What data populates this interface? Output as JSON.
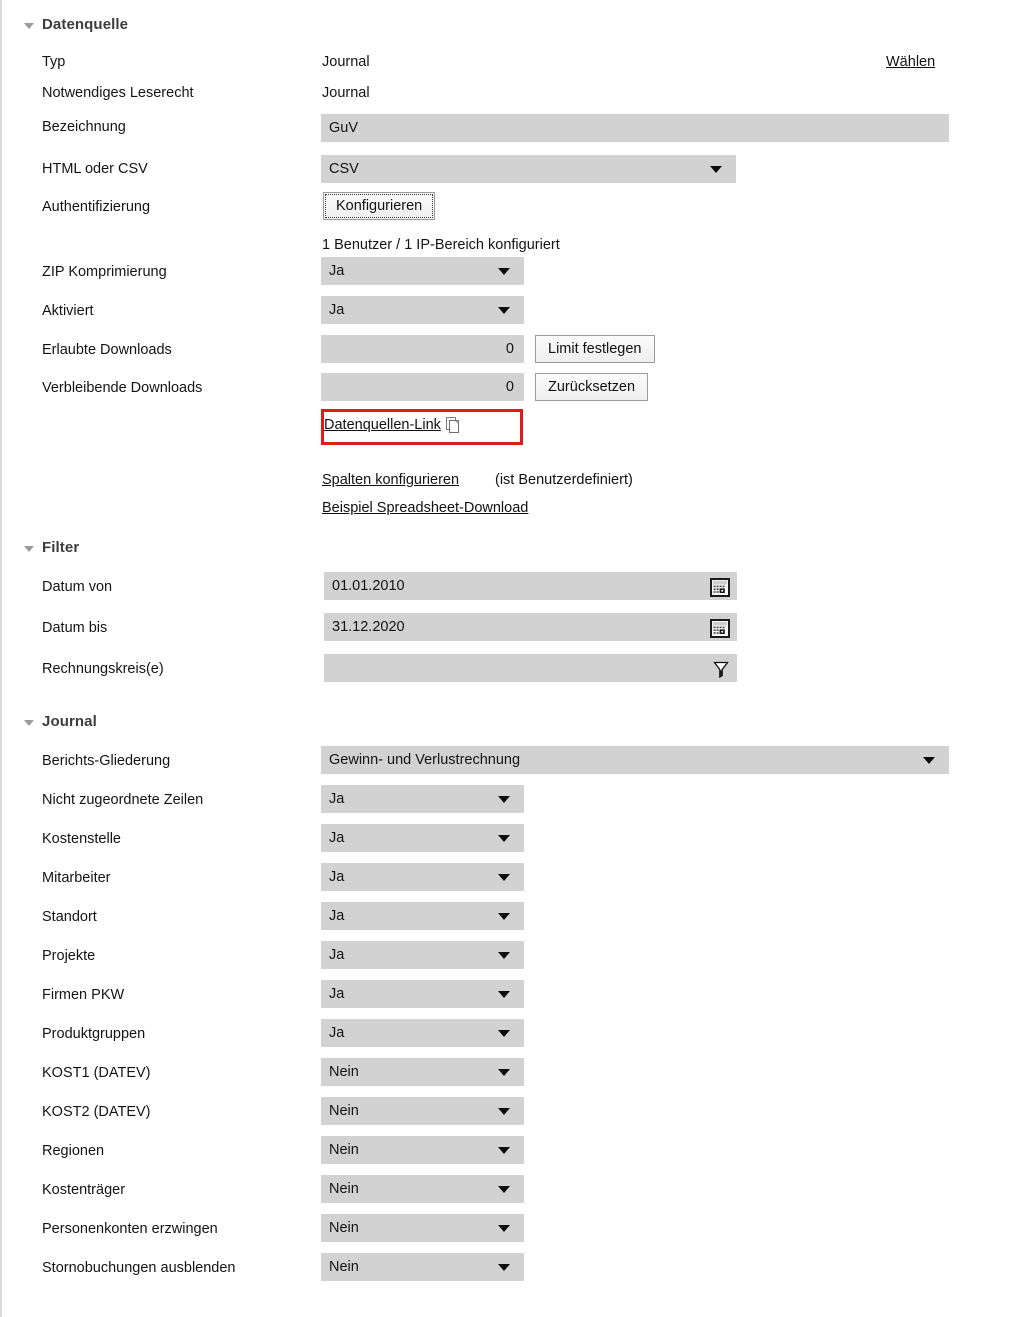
{
  "sections": {
    "datenquelle": {
      "title": "Datenquelle",
      "rows": {
        "typ": {
          "label": "Typ",
          "value": "Journal",
          "action_link": "Wählen"
        },
        "leserecht": {
          "label": "Notwendiges Leserecht",
          "value": "Journal"
        },
        "bezeichnung": {
          "label": "Bezeichnung",
          "value": "GuV"
        },
        "format": {
          "label": "HTML oder CSV",
          "value": "CSV"
        },
        "auth": {
          "label": "Authentifizierung",
          "button": "Konfigurieren",
          "status": "1 Benutzer / 1 IP-Bereich konfiguriert"
        },
        "zip": {
          "label": "ZIP Komprimierung",
          "value": "Ja"
        },
        "aktiviert": {
          "label": "Aktiviert",
          "value": "Ja"
        },
        "erlaubte": {
          "label": "Erlaubte Downloads",
          "value": "0",
          "button": "Limit festlegen"
        },
        "verbleibende": {
          "label": "Verbleibende Downloads",
          "value": "0",
          "button": "Zurücksetzen"
        }
      },
      "links": {
        "datenquellen_link": "Datenquellen-Link",
        "spalten_link": "Spalten konfigurieren",
        "spalten_suffix": "(ist Benutzerdefiniert)",
        "beispiel_link": "Beispiel Spreadsheet-Download"
      }
    },
    "filter": {
      "title": "Filter",
      "rows": {
        "datum_von": {
          "label": "Datum von",
          "value": "01.01.2010"
        },
        "datum_bis": {
          "label": "Datum bis",
          "value": "31.12.2020"
        },
        "rechnungskreise": {
          "label": "Rechnungskreis(e)",
          "value": ""
        }
      }
    },
    "journal": {
      "title": "Journal",
      "gliederung": {
        "label": "Berichts-Gliederung",
        "value": "Gewinn- und Verlustrechnung"
      },
      "options": [
        {
          "label": "Nicht zugeordnete Zeilen",
          "value": "Ja"
        },
        {
          "label": "Kostenstelle",
          "value": "Ja"
        },
        {
          "label": "Mitarbeiter",
          "value": "Ja"
        },
        {
          "label": "Standort",
          "value": "Ja"
        },
        {
          "label": "Projekte",
          "value": "Ja"
        },
        {
          "label": "Firmen PKW",
          "value": "Ja"
        },
        {
          "label": "Produktgruppen",
          "value": "Ja"
        },
        {
          "label": "KOST1 (DATEV)",
          "value": "Nein"
        },
        {
          "label": "KOST2 (DATEV)",
          "value": "Nein"
        },
        {
          "label": "Regionen",
          "value": "Nein"
        },
        {
          "label": "Kostenträger",
          "value": "Nein"
        },
        {
          "label": "Personenkonten erzwingen",
          "value": "Nein"
        },
        {
          "label": "Stornobuchungen ausblenden",
          "value": "Nein"
        }
      ]
    }
  },
  "colors": {
    "field_bg": "#d2d2d2",
    "highlight": "#e01b1b",
    "section_title": "#3d3d3d"
  }
}
